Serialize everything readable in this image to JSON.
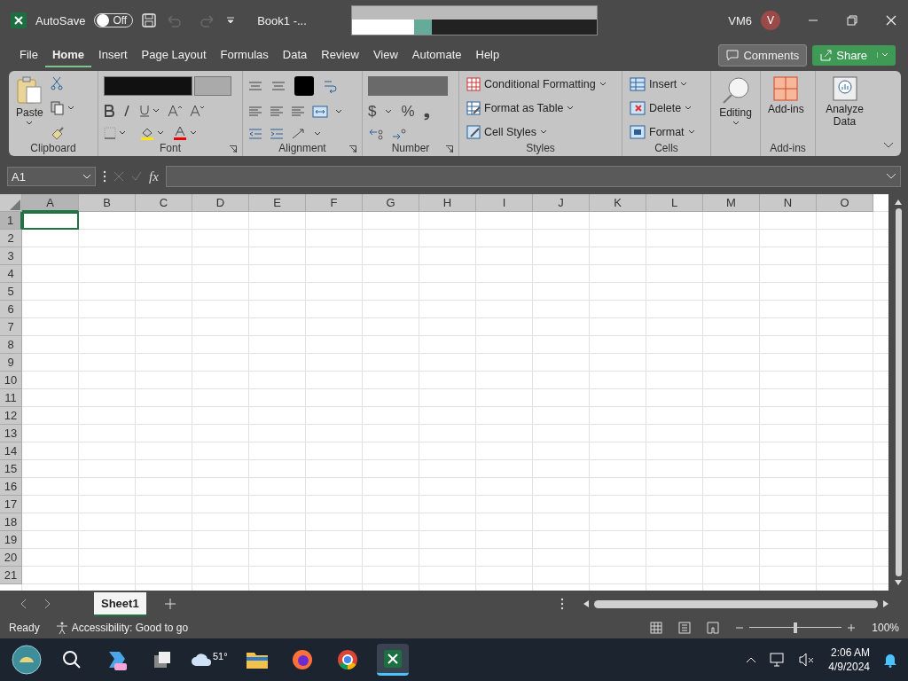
{
  "title_bar": {
    "autosave_label": "AutoSave",
    "autosave": {
      "on": false,
      "label": "Off"
    },
    "document_title": "Book1 -...",
    "account_name": "VM6",
    "avatar_initial": "V"
  },
  "menu_tabs": [
    {
      "label": "File",
      "selected": false
    },
    {
      "label": "Home",
      "selected": true
    },
    {
      "label": "Insert",
      "selected": false
    },
    {
      "label": "Page Layout",
      "selected": false
    },
    {
      "label": "Formulas",
      "selected": false
    },
    {
      "label": "Data",
      "selected": false
    },
    {
      "label": "Review",
      "selected": false
    },
    {
      "label": "View",
      "selected": false
    },
    {
      "label": "Automate",
      "selected": false
    },
    {
      "label": "Help",
      "selected": false
    }
  ],
  "comments_button": "Comments",
  "share_button": "Share",
  "ribbon": {
    "clipboard": {
      "paste": "Paste",
      "label": "Clipboard"
    },
    "font": {
      "label": "Font"
    },
    "alignment": {
      "label": "Alignment"
    },
    "number": {
      "currency": "$",
      "percent": "%",
      "comma": "❟",
      "label": "Number"
    },
    "styles": {
      "items": [
        {
          "label": "Conditional Formatting",
          "kind": "conditional"
        },
        {
          "label": "Format as Table",
          "kind": "table"
        },
        {
          "label": "Cell Styles",
          "kind": "styles"
        }
      ],
      "label": "Styles"
    },
    "cells": {
      "items": [
        {
          "label": "Insert",
          "kind": "insert"
        },
        {
          "label": "Delete",
          "kind": "delete"
        },
        {
          "label": "Format",
          "kind": "format"
        }
      ],
      "label": "Cells"
    },
    "editing": {
      "label": "Editing"
    },
    "addins": {
      "button": "Add-ins",
      "label": "Add-ins"
    },
    "analyze": {
      "button": "Analyze Data"
    }
  },
  "formula_bar": {
    "name_box": "A1",
    "fx": "fx"
  },
  "sheet": {
    "columns": [
      {
        "label": "A",
        "selected": true
      },
      {
        "label": "B",
        "selected": false
      },
      {
        "label": "C",
        "selected": false
      },
      {
        "label": "D",
        "selected": false
      },
      {
        "label": "E",
        "selected": false
      },
      {
        "label": "F",
        "selected": false
      },
      {
        "label": "G",
        "selected": false
      },
      {
        "label": "H",
        "selected": false
      },
      {
        "label": "I",
        "selected": false
      },
      {
        "label": "J",
        "selected": false
      },
      {
        "label": "K",
        "selected": false
      },
      {
        "label": "L",
        "selected": false
      },
      {
        "label": "M",
        "selected": false
      },
      {
        "label": "N",
        "selected": false
      },
      {
        "label": "O",
        "selected": false
      }
    ],
    "rows": [
      {
        "label": "1",
        "selected": true
      },
      {
        "label": "2",
        "selected": false
      },
      {
        "label": "3",
        "selected": false
      },
      {
        "label": "4",
        "selected": false
      },
      {
        "label": "5",
        "selected": false
      },
      {
        "label": "6",
        "selected": false
      },
      {
        "label": "7",
        "selected": false
      },
      {
        "label": "8",
        "selected": false
      },
      {
        "label": "9",
        "selected": false
      },
      {
        "label": "10",
        "selected": false
      },
      {
        "label": "11",
        "selected": false
      },
      {
        "label": "12",
        "selected": false
      },
      {
        "label": "13",
        "selected": false
      },
      {
        "label": "14",
        "selected": false
      },
      {
        "label": "15",
        "selected": false
      },
      {
        "label": "16",
        "selected": false
      },
      {
        "label": "17",
        "selected": false
      },
      {
        "label": "18",
        "selected": false
      },
      {
        "label": "19",
        "selected": false
      },
      {
        "label": "20",
        "selected": false
      },
      {
        "label": "21",
        "selected": false
      }
    ]
  },
  "sheet_tabs": [
    {
      "label": "Sheet1",
      "selected": true
    }
  ],
  "status_bar": {
    "mode": "Ready",
    "accessibility": "Accessibility: Good to go",
    "zoom": {
      "level": 0.5,
      "label": "100%"
    }
  },
  "taskbar": {
    "weather": "51°",
    "time": "2:06 AM",
    "date": "4/9/2024"
  }
}
